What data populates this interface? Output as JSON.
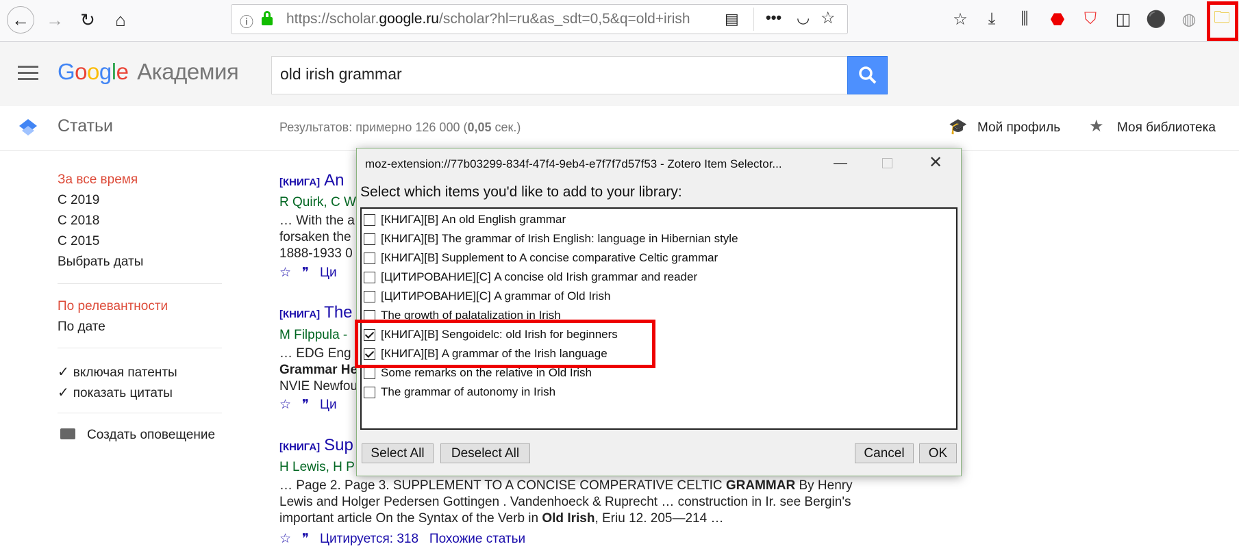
{
  "browser": {
    "url_prefix": "https://scholar.",
    "url_domain": "google.ru",
    "url_suffix": "/scholar?hl=ru&as_sdt=0,5&q=old+irish"
  },
  "scholar": {
    "logo_google": [
      "G",
      "o",
      "o",
      "g",
      "l",
      "e"
    ],
    "logo_product": "Академия",
    "search_value": "old irish  grammar",
    "section_title": "Статьи",
    "results_count_prefix": "Результатов: примерно 126 000 (",
    "results_time": "0,05",
    "results_count_suffix": " сек.)",
    "my_profile": "Мой профиль",
    "my_library": "Моя библиотека"
  },
  "sidebar": {
    "time_filters": [
      "За все время",
      "С 2019",
      "С 2018",
      "С 2015",
      "Выбрать даты"
    ],
    "sort_options": [
      "По релевантности",
      "По дате"
    ],
    "checkboxes": [
      "включая патенты",
      "показать цитаты"
    ],
    "create_alert": "Создать оповещение"
  },
  "results": [
    {
      "tag": "[КНИГА]",
      "title": "An",
      "authors": "R Quirk, C W",
      "snippet_lines": [
        "… With the a",
        "forsaken the",
        "1888-1933 0"
      ]
    },
    {
      "tag": "[КНИГА]",
      "title": "The",
      "authors": "M Filppula -",
      "snippet_lines": [
        "… EDG Eng",
        "Grammar He",
        "NVIE Newfou"
      ]
    },
    {
      "tag": "[КНИГА]",
      "title": "Sup",
      "authors": "H Lewis, H P",
      "snippet_lines": [
        "… Page 2. Page 3. SUPPLEMENT TO A CONCISE COMPERATIVE CELTIC ",
        "Lewis and Holger Pedersen Gottingen . Vandenhoeck & Ruprecht … construction in Ir. see Bergin's",
        "important article On the Syntax of the Verb in "
      ],
      "snippet_bold_1": "GRAMMAR",
      "snippet_after_1": " By Henry",
      "snippet_bold_3": "Old Irish",
      "snippet_after_3": ", Eriu 12. 205—214 …",
      "cited_by": "Цитируется: 318",
      "related": "Похожие статьи"
    }
  ],
  "result_link_short": "Ци",
  "dialog": {
    "title": "moz-extension://77b03299-834f-47f4-9eb4-e7f7f7d57f53 - Zotero Item Selector...",
    "prompt": "Select which items you'd like to add to your library:",
    "items": [
      {
        "label": "[КНИГА][B] An old English grammar",
        "checked": false
      },
      {
        "label": "[КНИГА][B] The grammar of Irish English: language in Hibernian style",
        "checked": false
      },
      {
        "label": "[КНИГА][B] Supplement to A concise comparative Celtic grammar",
        "checked": false
      },
      {
        "label": "[ЦИТИРОВАНИЕ][C] A concise old Irish grammar and reader",
        "checked": false
      },
      {
        "label": "[ЦИТИРОВАНИЕ][C] A grammar of Old Irish",
        "checked": false
      },
      {
        "label": "The growth of palatalization in Irish",
        "checked": false
      },
      {
        "label": "[КНИГА][B] Sengoidelc: old Irish for beginners",
        "checked": true
      },
      {
        "label": "[КНИГА][B] A grammar of the Irish language",
        "checked": true
      },
      {
        "label": "Some remarks on the relative in Old Irish",
        "checked": false
      },
      {
        "label": "The grammar of autonomy in Irish",
        "checked": false
      }
    ],
    "select_all": "Select All",
    "deselect_all": "Deselect All",
    "cancel": "Cancel",
    "ok": "OK"
  },
  "colors": {
    "highlight": "#ee0000",
    "link": "#1a0dab",
    "author": "#006621",
    "accent": "#dd4b39",
    "search_button": "#4d90fe"
  }
}
